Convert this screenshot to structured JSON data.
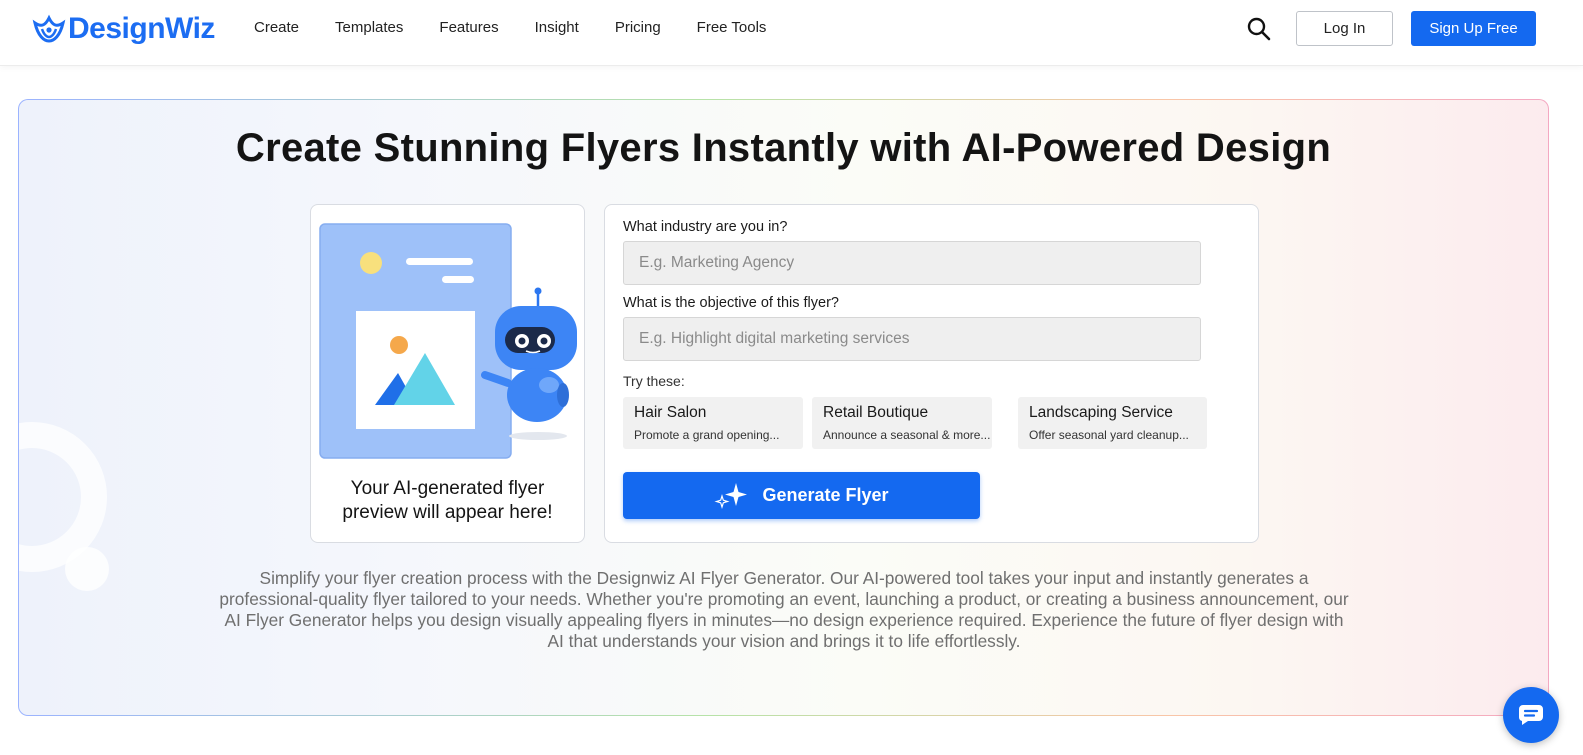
{
  "brand": {
    "name": "DesignWiz",
    "color": "#1c6df2"
  },
  "nav": {
    "links": [
      "Create",
      "Templates",
      "Features",
      "Insight",
      "Pricing",
      "Free Tools"
    ],
    "login_label": "Log In",
    "signup_label": "Sign Up Free"
  },
  "hero": {
    "title": "Create Stunning Flyers Instantly with AI-Powered Design",
    "preview_caption_line1": "Your AI-generated flyer",
    "preview_caption_line2": "preview will appear here!",
    "form": {
      "industry_label": "What industry are you in?",
      "industry_placeholder": "E.g. Marketing Agency",
      "industry_value": "",
      "objective_label": "What is the objective of this flyer?",
      "objective_placeholder": "E.g. Highlight digital marketing services",
      "objective_value": "",
      "try_label": "Try these:",
      "suggestions": [
        {
          "title": "Hair Salon",
          "subtitle": "Promote a grand opening..."
        },
        {
          "title": "Retail Boutique",
          "subtitle": "Announce a seasonal & more..."
        },
        {
          "title": "Landscaping Service",
          "subtitle": "Offer seasonal yard cleanup..."
        }
      ],
      "generate_label": "Generate Flyer"
    },
    "description": "Simplify your flyer creation process with the Designwiz AI Flyer Generator. Our AI-powered tool takes your input and instantly generates a professional-quality flyer tailored to your needs. Whether you're promoting an event, launching a product, or creating a business announcement, our AI Flyer Generator helps you design visually appealing flyers in minutes—no design experience required. Experience the future of flyer design with AI that understands your vision and brings it to life effortlessly."
  },
  "icons": {
    "search": "search-icon",
    "chat": "chat-icon",
    "sparkle": "sparkle-icon"
  },
  "colors": {
    "primary": "#1469f0",
    "title_text": "#141414",
    "muted_text": "#6f6f6f"
  }
}
